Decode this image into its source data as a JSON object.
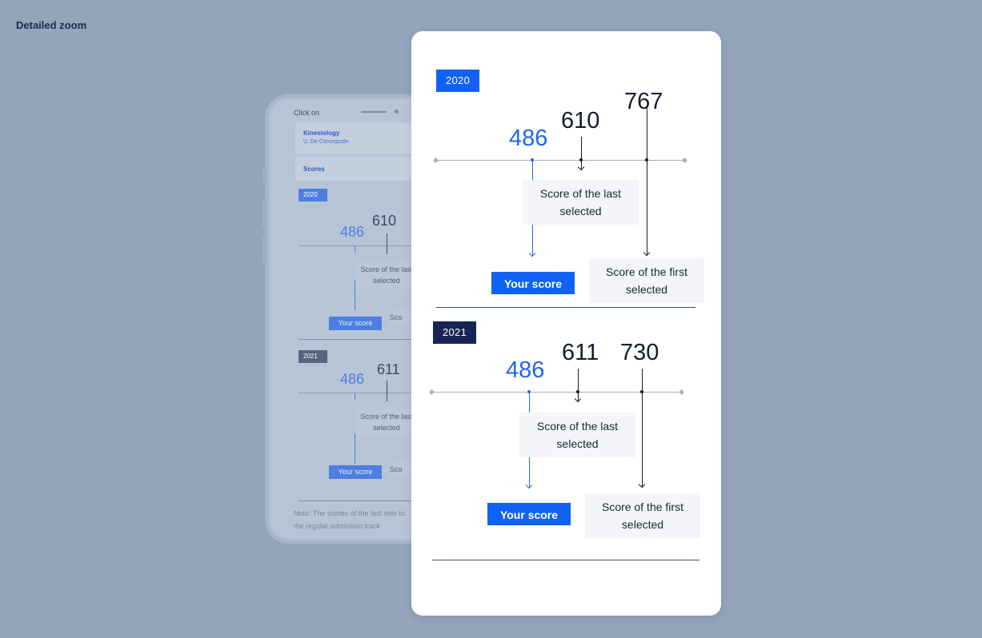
{
  "page": {
    "heading": "Detailed zoom"
  },
  "phone": {
    "header_text": "Click on",
    "card": {
      "title": "Kinesiology",
      "subtitle": "U. De Concepción"
    },
    "scores_label": "Scores",
    "sections": [
      {
        "year": "2020",
        "your_score": "486",
        "last_selected": "610",
        "last_label": "Score of the last selected",
        "button": "Your score",
        "first_label_fragment": "Sco"
      },
      {
        "year": "2021",
        "your_score": "486",
        "last_selected": "611",
        "last_label": "Score of the last selected",
        "button": "Your score",
        "first_label_fragment": "Sco"
      }
    ],
    "note": "Note: The scores of the last sele to the regular admission track"
  },
  "zoom": {
    "sections": [
      {
        "year": "2020",
        "your_score": "486",
        "last_selected": "610",
        "first_selected": "767",
        "last_label": "Score of the last selected",
        "first_label": "Score of the first selected",
        "button": "Your score",
        "tag_color": "#1062f2"
      },
      {
        "year": "2021",
        "your_score": "486",
        "last_selected": "611",
        "first_selected": "730",
        "last_label": "Score of the last selected",
        "first_label": "Score of the first selected",
        "button": "Your score",
        "tag_color": "#172554"
      }
    ]
  },
  "colors": {
    "accent": "#1062f2",
    "dark_tag": "#172554",
    "background": "#93a4bb"
  }
}
